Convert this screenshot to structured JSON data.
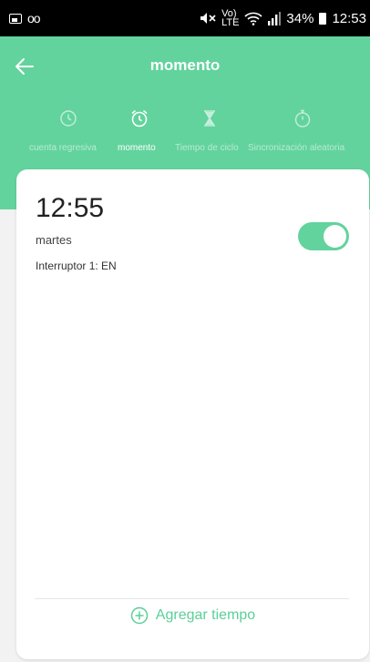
{
  "status_bar": {
    "battery": "34%",
    "time": "12:53",
    "icons": [
      "image-icon",
      "voicemail-icon",
      "mute-icon",
      "volte-icon",
      "wifi-icon",
      "signal-icon",
      "battery-icon"
    ]
  },
  "header": {
    "title": "momento",
    "color": "#62d39d"
  },
  "tabs": [
    {
      "label": "cuenta regresiva",
      "icon": "clock-icon",
      "active": false
    },
    {
      "label": "momento",
      "icon": "alarm-clock-icon",
      "active": true
    },
    {
      "label": "Tiempo de ciclo",
      "icon": "hourglass-icon",
      "active": false
    },
    {
      "label": "Sincronización aleatoria",
      "icon": "stopwatch-icon",
      "active": false
    }
  ],
  "timer": {
    "time": "12:55",
    "day": "martes",
    "switch_state": "Interruptor 1: EN",
    "enabled": true
  },
  "add_time": {
    "label": "Agregar tiempo"
  }
}
